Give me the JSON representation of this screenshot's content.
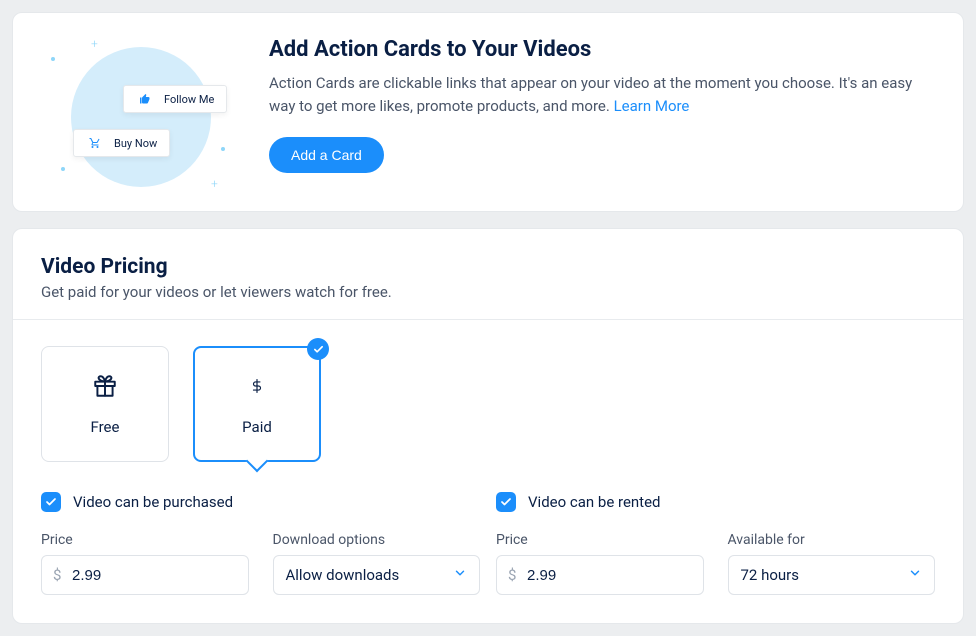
{
  "actionCards": {
    "title": "Add Action Cards to Your Videos",
    "description": "Action Cards are clickable links that appear on your video at the moment you choose. It's an easy way to get more likes, promote products, and more. ",
    "learnMore": "Learn More",
    "addButton": "Add a Card",
    "illus": {
      "follow": "Follow Me",
      "buy": "Buy Now"
    }
  },
  "pricing": {
    "title": "Video Pricing",
    "subtitle": "Get paid for your videos or let viewers watch for free.",
    "options": {
      "free": "Free",
      "paid": "Paid"
    },
    "purchase": {
      "checkboxLabel": "Video can be purchased",
      "priceLabel": "Price",
      "priceValue": "2.99",
      "downloadLabel": "Download options",
      "downloadValue": "Allow downloads"
    },
    "rent": {
      "checkboxLabel": "Video can be rented",
      "priceLabel": "Price",
      "priceValue": "2.99",
      "availableLabel": "Available for",
      "availableValue": "72 hours"
    }
  }
}
